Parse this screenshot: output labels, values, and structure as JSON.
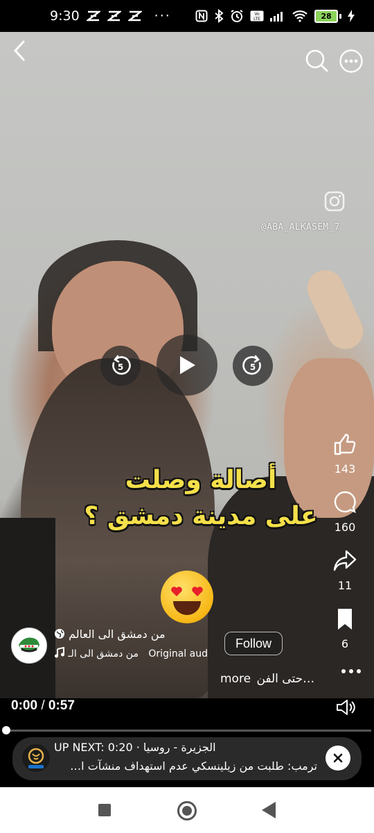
{
  "status_bar": {
    "time": "9:30",
    "notif_icons": [
      "ZZZ",
      "ZZZ",
      "ZZZ"
    ],
    "more": "···",
    "battery": "28"
  },
  "video": {
    "instagram_handle": "@ABA_ALKASEM_7",
    "caption_line1": "أصالة وصلت",
    "caption_line2": "على مدينة دمشق ؟",
    "rewind_seconds": "5",
    "forward_seconds": "5"
  },
  "actions": {
    "likes": "143",
    "comments": "160",
    "shares": "11",
    "saves": "6"
  },
  "channel": {
    "title": "من دمشق الى العالم",
    "audio_artist": "من دمشق الى الـ",
    "audio_label": "Original aud",
    "follow_label": "Follow",
    "description": "حتى الفن…",
    "more_label": "more"
  },
  "player": {
    "current_time": "0:00",
    "separator": "/",
    "duration": "0:57",
    "progress": 0.0
  },
  "up_next": {
    "label": "UP NEXT:",
    "source": "الجزيرة - روسيا",
    "time": "0:20",
    "title": "ترمب: طلبت من زيلينسكي عدم استهداف منشآت ا…"
  }
}
